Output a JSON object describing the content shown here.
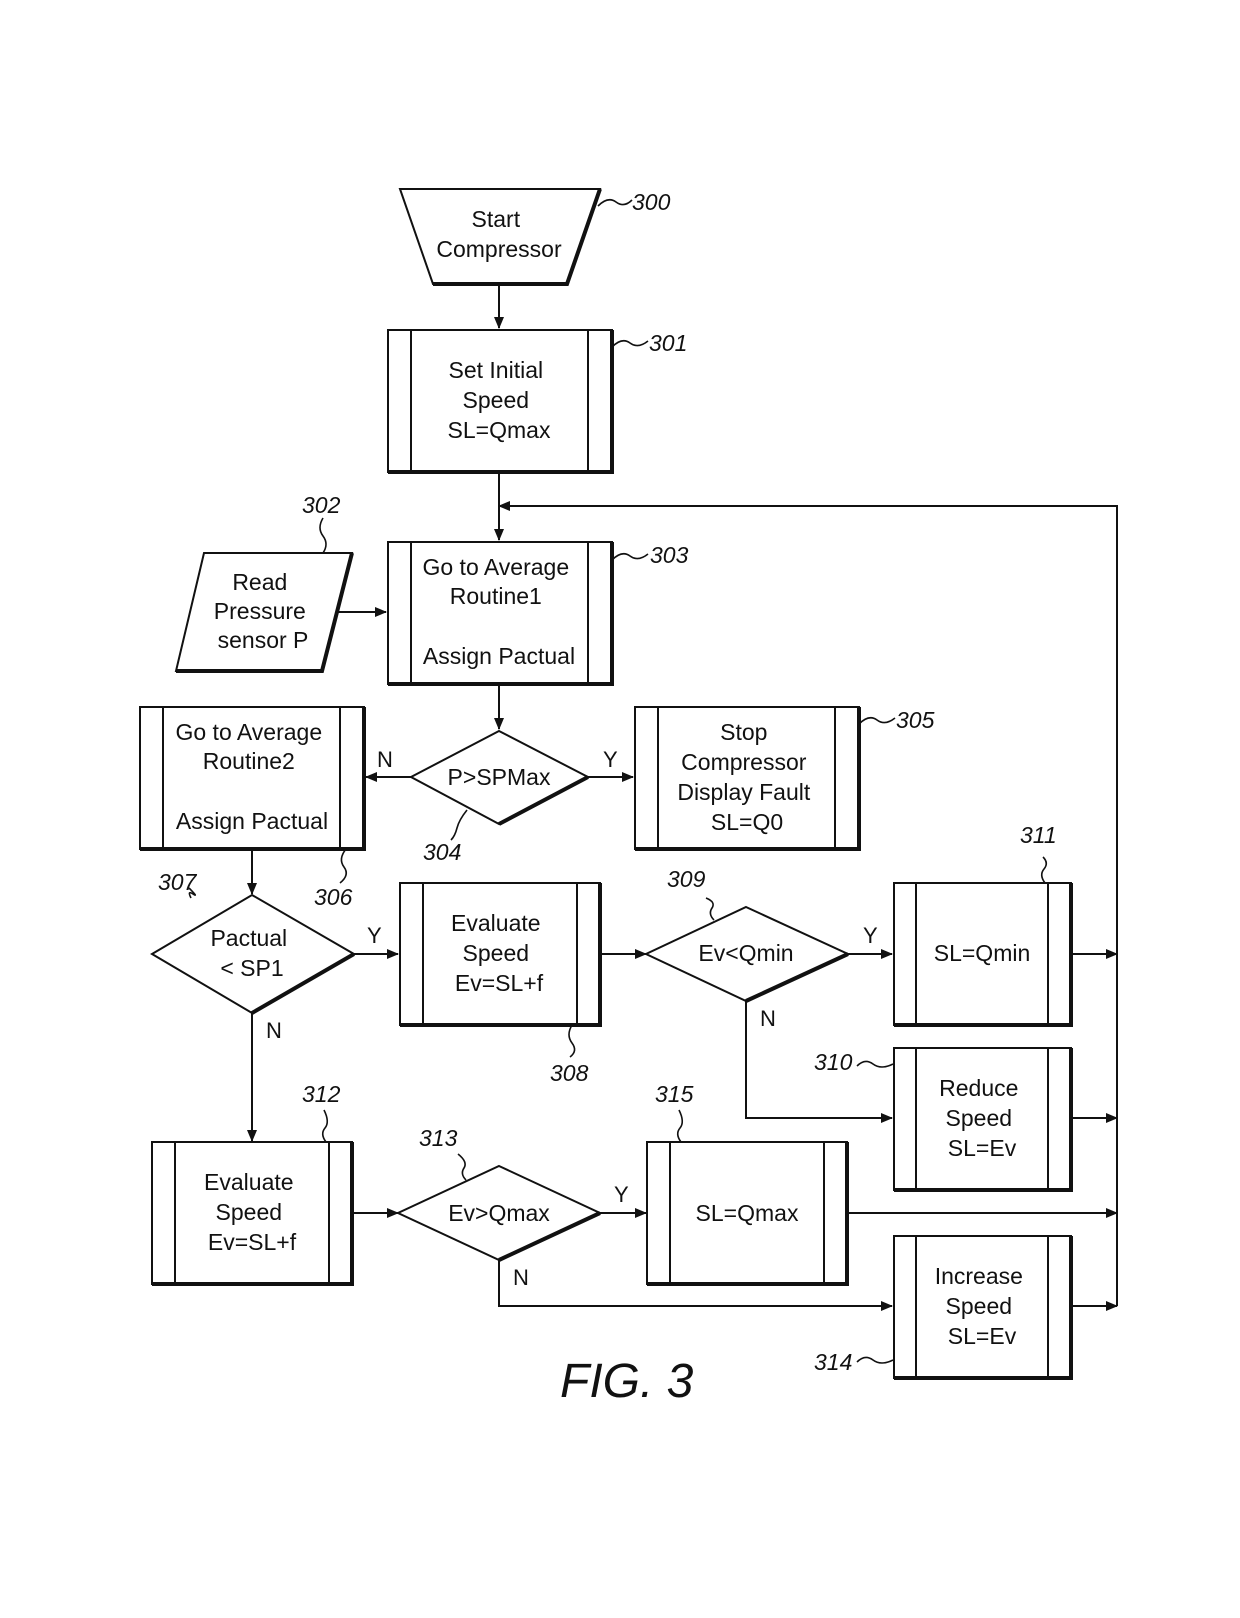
{
  "figure": {
    "caption": "FIG. 3",
    "nodes": {
      "n300": {
        "ref": "300",
        "lines": [
          "Start",
          "Compressor"
        ]
      },
      "n301": {
        "ref": "301",
        "lines": [
          "Set Initial",
          "Speed",
          "SL=Qmax"
        ]
      },
      "n302": {
        "ref": "302",
        "lines": [
          "Read",
          "Pressure",
          "sensor P"
        ]
      },
      "n303": {
        "ref": "303",
        "lines": [
          "Go to Average",
          "Routine1",
          "",
          "Assign Pactual"
        ]
      },
      "n304": {
        "ref": "304",
        "lines": [
          "P>SPMax"
        ]
      },
      "n305": {
        "ref": "305",
        "lines": [
          "Stop",
          "Compressor",
          "Display Fault",
          "SL=Q0"
        ]
      },
      "n306": {
        "ref": "306",
        "lines": [
          "Go to Average",
          "Routine2",
          "",
          "Assign Pactual"
        ]
      },
      "n307": {
        "ref": "307",
        "lines": [
          "Pactual",
          "< SP1"
        ]
      },
      "n308": {
        "ref": "308",
        "lines": [
          "Evaluate",
          "Speed",
          "Ev=SL+f"
        ]
      },
      "n309": {
        "ref": "309",
        "lines": [
          "Ev<Qmin"
        ]
      },
      "n310": {
        "ref": "310",
        "lines": [
          "Reduce",
          "Speed",
          "SL=Ev"
        ]
      },
      "n311": {
        "ref": "311",
        "lines": [
          "SL=Qmin"
        ]
      },
      "n312": {
        "ref": "312",
        "lines": [
          "Evaluate",
          "Speed",
          "Ev=SL+f"
        ]
      },
      "n313": {
        "ref": "313",
        "lines": [
          "Ev>Qmax"
        ]
      },
      "n314": {
        "ref": "314",
        "lines": [
          "Increase",
          "Speed",
          "SL=Ev"
        ]
      },
      "n315": {
        "ref": "315",
        "lines": [
          "SL=Qmax"
        ]
      }
    },
    "branch_labels": {
      "b304_no": "N",
      "b304_yes": "Y",
      "b307_yes": "Y",
      "b307_no": "N",
      "b309_yes": "Y",
      "b309_no": "N",
      "b313_yes": "Y",
      "b313_no": "N"
    }
  }
}
